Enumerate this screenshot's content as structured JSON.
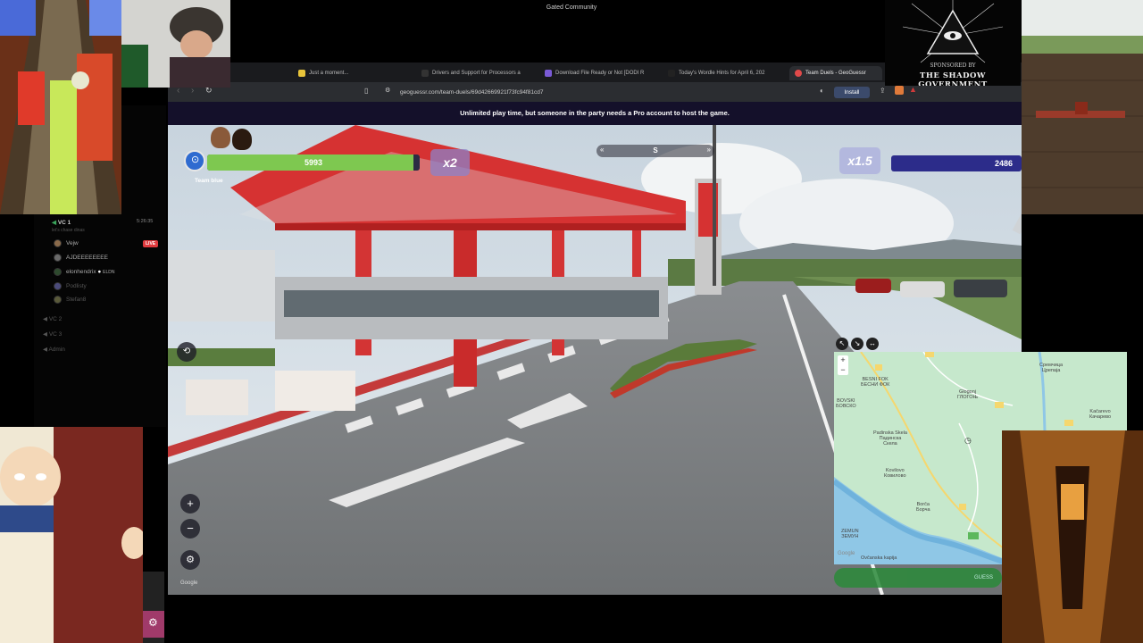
{
  "window_title": "Gated Community",
  "sidebar": {
    "channel_main": "VC 1",
    "channel_time": "5:26:35",
    "channel_sub": "let's chase dinas",
    "members": [
      {
        "name": "Vejw",
        "badge": "LIVE"
      },
      {
        "name": "AJDEEEEEEEE",
        "badge": ""
      },
      {
        "name": "elonhendrix",
        "badge": "ELDN"
      },
      {
        "name": "Podlisty",
        "badge": ""
      },
      {
        "name": "Stefan8",
        "badge": ""
      }
    ],
    "channels": [
      "VC 2",
      "VC 3",
      "Admin"
    ]
  },
  "browser": {
    "tabs": [
      {
        "label": "Just a moment...",
        "color": "#e8c43a"
      },
      {
        "label": "Drivers and Support for Processors a",
        "color": "#333333"
      },
      {
        "label": "Download File Ready or Not [DODI R",
        "color": "#7a5ad6"
      },
      {
        "label": "Today's Wordle Hints for April 6, 202",
        "color": "#222222"
      },
      {
        "label": "Team Duels - GeoGuessr",
        "color": "#e04a4a"
      }
    ],
    "url": "geoguessr.com/team-duels/69d42669921f73fc94f81cd7",
    "install_label": "Install",
    "banner": "Unlimited play time, but someone in the party needs a Pro account to host the game."
  },
  "hud": {
    "team_label": "Team blue",
    "left_score": "5993",
    "left_health_fraction": 0.97,
    "left_multiplier": "x2",
    "right_multiplier": "x1.5",
    "right_score": "2486",
    "compass_heading": "S",
    "team_color": "#7ec850",
    "enemy_color": "#3a3ab0"
  },
  "minimap": {
    "labels": [
      {
        "text": "Сремчица\nЦрепаја"
      },
      {
        "text": "BESNI FOK\nБЕСНИ ФОК"
      },
      {
        "text": "BOVSKI\nБОВСКО"
      },
      {
        "text": "Glogonj\nГЛОГОЊ"
      },
      {
        "text": "Kačarevo\nКачарево"
      },
      {
        "text": "Padinska Skela\nПадинска\nСкела"
      },
      {
        "text": "Kovilovo\nКовилово"
      },
      {
        "text": "Borča\nБорча"
      },
      {
        "text": "ZEMUN\nЗЕМУН"
      },
      {
        "text": "Ovčanska kapija"
      }
    ],
    "google_label": "Google",
    "guess_label": "GUESS"
  },
  "overlays": {
    "shadow_text": "THE SHADOW GOVERNMENT",
    "shadow_sub": "SPONSORED BY"
  },
  "street_view": {
    "google_label": "Google",
    "zoom_in": "+",
    "zoom_out": "−"
  }
}
